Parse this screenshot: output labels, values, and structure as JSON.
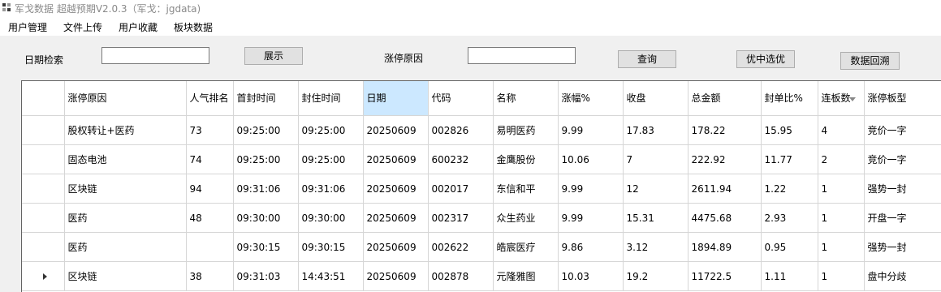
{
  "window": {
    "title": "军戈数据 超越预期V2.0.3（军戈：jgdata)"
  },
  "menu": [
    "用户管理",
    "文件上传",
    "用户收藏",
    "板块数据"
  ],
  "search": {
    "date_label": "日期检索",
    "date_value": "",
    "show_button": "展示",
    "reason_label": "涨停原因",
    "reason_value": "",
    "query_button": "查询",
    "select_button": "优中选优",
    "backtest_button": "数据回溯"
  },
  "grid": {
    "columns": [
      "涨停原因",
      "人气排名",
      "首封时间",
      "封住时间",
      "日期",
      "代码",
      "名称",
      "涨幅%",
      "收盘",
      "总金额",
      "封单比%",
      "连板数",
      "涨停板型"
    ],
    "rows": [
      [
        "股权转让+医药",
        "73",
        "09:25:00",
        "09:25:00",
        "20250609",
        "002826",
        "易明医药",
        "9.99",
        "17.83",
        "178.22",
        "15.95",
        "4",
        "竞价一字"
      ],
      [
        "固态电池",
        "74",
        "09:25:00",
        "09:25:00",
        "20250609",
        "600232",
        "金鹰股份",
        "10.06",
        "7",
        "222.92",
        "11.77",
        "2",
        "竞价一字"
      ],
      [
        "区块链",
        "94",
        "09:31:06",
        "09:31:06",
        "20250609",
        "002017",
        "东信和平",
        "9.99",
        "12",
        "2611.94",
        "1.22",
        "1",
        "强势一封"
      ],
      [
        "医药",
        "48",
        "09:30:00",
        "09:30:00",
        "20250609",
        "002317",
        "众生药业",
        "9.99",
        "15.31",
        "4475.68",
        "2.93",
        "1",
        "开盘一字"
      ],
      [
        "医药",
        "",
        "09:30:15",
        "09:30:15",
        "20250609",
        "002622",
        "皓宸医疗",
        "9.86",
        "3.12",
        "1894.89",
        "0.95",
        "1",
        "强势一封"
      ],
      [
        "区块链",
        "38",
        "09:31:03",
        "14:43:51",
        "20250609",
        "002878",
        "元隆雅图",
        "10.03",
        "19.2",
        "11722.5",
        "1.11",
        "1",
        "盘中分歧"
      ]
    ]
  }
}
